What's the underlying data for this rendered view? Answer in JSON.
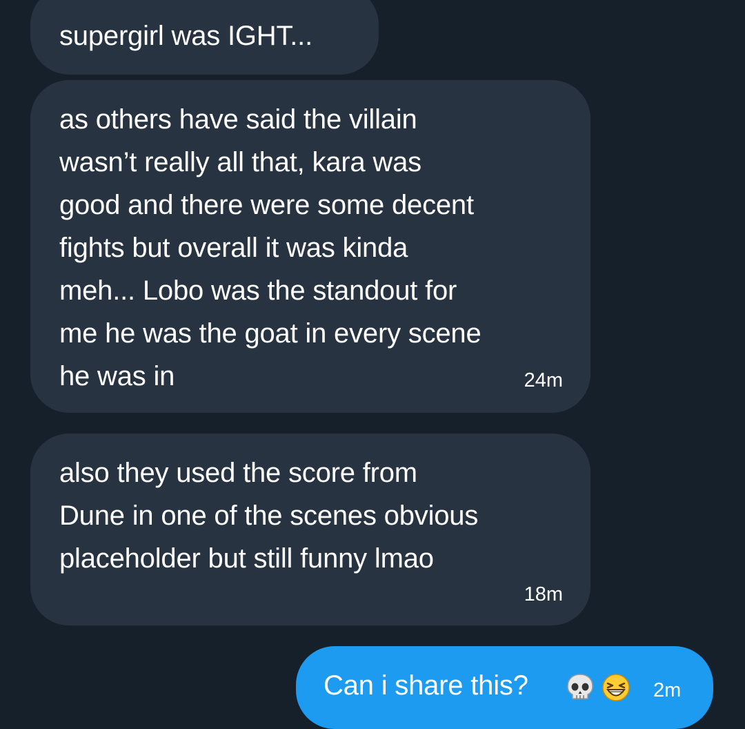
{
  "messages": [
    {
      "text": "supergirl was IGHT...",
      "direction": "incoming"
    },
    {
      "text": "as others have said the villain\nwasn’t really all that, kara was\ngood and there were some decent\nfights but overall it was kinda\nmeh... Lobo was the standout for\nme he was the goat in every scene\nhe was in",
      "timestamp": "24m",
      "direction": "incoming"
    },
    {
      "text": "also they used the score from\nDune in one of the scenes obvious\nplaceholder but still funny lmao",
      "timestamp": "18m",
      "direction": "incoming"
    },
    {
      "text": "Can i share this?",
      "emojis": [
        "skull-emoji",
        "grinning-squinting-face-emoji"
      ],
      "timestamp": "2m",
      "direction": "outgoing"
    }
  ],
  "colors": {
    "background": "#15202b",
    "incoming_bubble": "#273340",
    "outgoing_bubble": "#1d9bf0",
    "text": "#ffffff"
  }
}
